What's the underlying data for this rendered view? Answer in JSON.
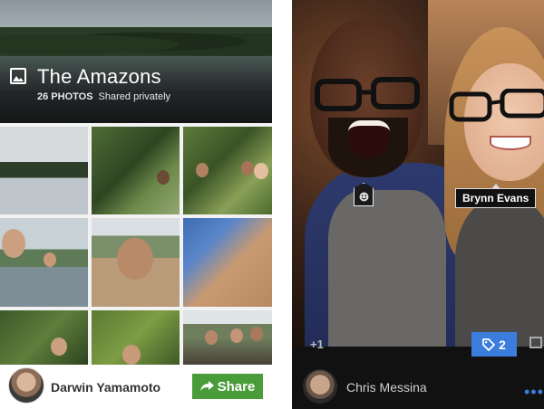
{
  "album": {
    "title": "The Amazons",
    "photo_count": "26 PHOTOS",
    "sharing": "Shared privately",
    "icon": "photo-album-icon"
  },
  "footer": {
    "owner_name": "Darwin Yamamoto",
    "share_label": "Share",
    "share_icon": "share-arrow-icon",
    "accent": "#4a9b3a"
  },
  "photo_view": {
    "face_tag_icon": "smiley-icon",
    "tag_name": "Brynn Evans",
    "plus_one": "+1",
    "tag_count": "2",
    "tag_icon": "tag-icon",
    "comment_icon": "comment-icon",
    "owner_name": "Chris Messina",
    "more_icon": "more-dots-icon",
    "accent": "#3b7ddd"
  }
}
